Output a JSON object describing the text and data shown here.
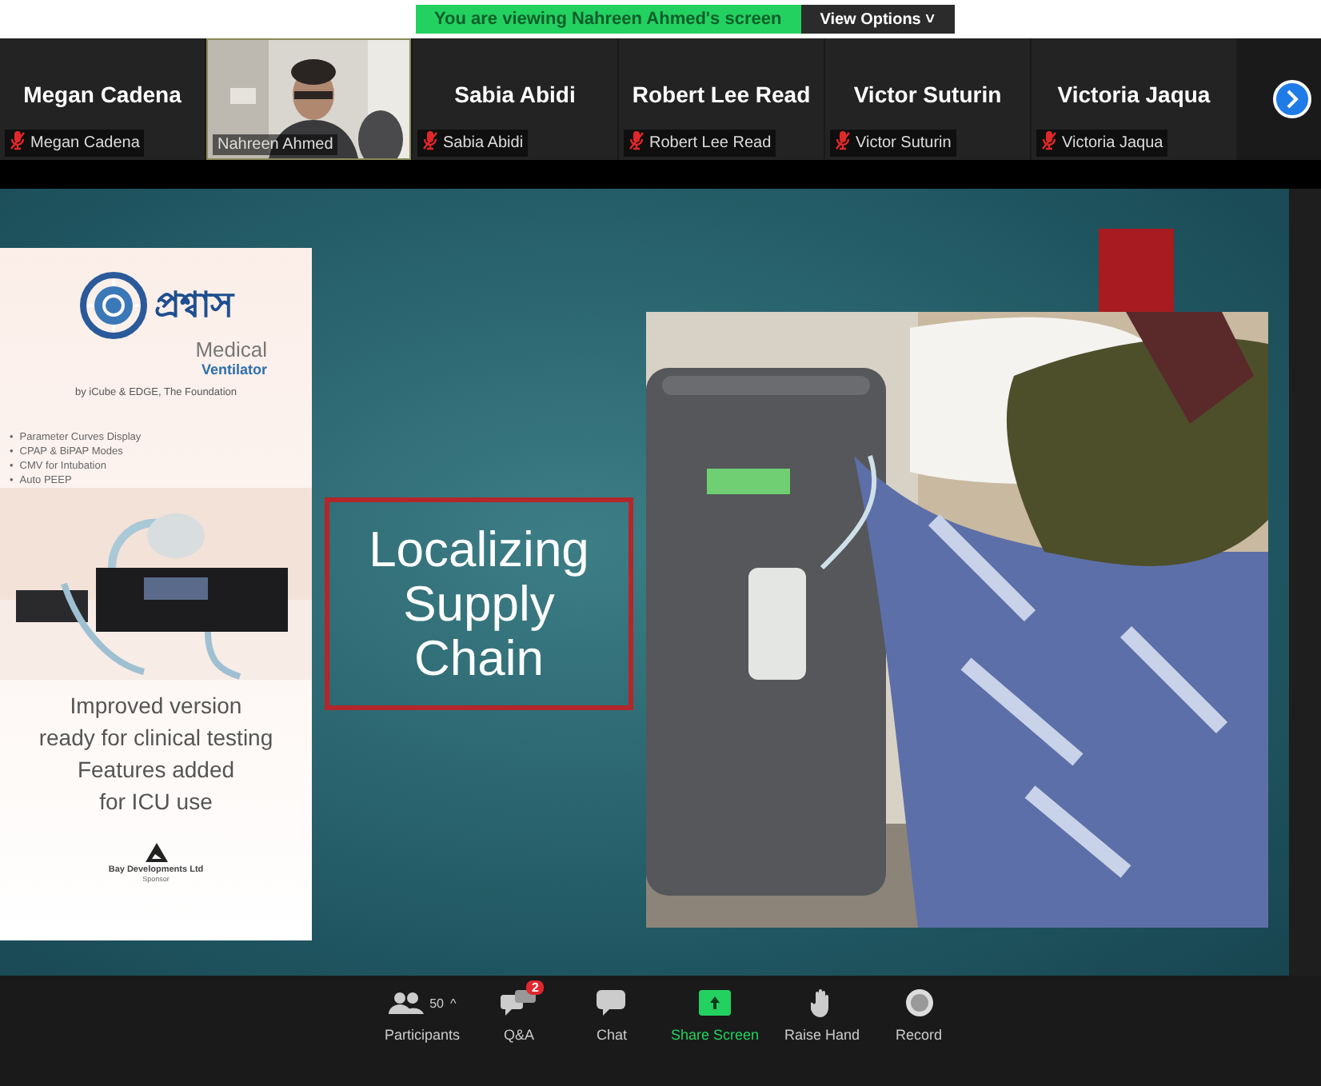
{
  "banner": {
    "text": "You are viewing Nahreen Ahmed's screen",
    "menu": "View Options",
    "menu_caret": "˅"
  },
  "participants": [
    {
      "kind": "name",
      "name": "Megan Cadena",
      "label": "Megan Cadena",
      "muted": true
    },
    {
      "kind": "video",
      "label": "Nahreen Ahmed",
      "muted": false
    },
    {
      "kind": "name",
      "name": "Sabia Abidi",
      "label": "Sabia Abidi",
      "muted": true
    },
    {
      "kind": "name",
      "name": "Robert Lee Read",
      "label": "Robert Lee Read",
      "muted": true
    },
    {
      "kind": "name",
      "name": "Victor Suturin",
      "label": "Victor Suturin",
      "muted": true
    },
    {
      "kind": "name",
      "name": "Victoria Jaqua",
      "label": "Victoria Jaqua",
      "muted": true
    }
  ],
  "slide": {
    "poster": {
      "wordmark": "প্রশ্বাস",
      "title": "Medical",
      "subtitle": "Ventilator",
      "byline": "by iCube  &  EDGE, The Foundation",
      "features": [
        {
          "bullet": "•",
          "text": "Parameter Curves Display"
        },
        {
          "bullet": "•",
          "text": "CPAP & BiPAP Modes"
        },
        {
          "bullet": "•",
          "text": "CMV for Intubation"
        },
        {
          "bullet": "•",
          "text": "Auto PEEP"
        }
      ],
      "caption": [
        "Improved version",
        "ready for clinical testing",
        "Features added",
        "for ICU use"
      ],
      "sponsor_name": "Bay Developments Ltd",
      "sponsor_label": "Sponsor"
    },
    "headline": "Localizing Supply Chain"
  },
  "toolbar": [
    {
      "kind": "participants",
      "label": "Participants",
      "count": "50",
      "caret": "^"
    },
    {
      "kind": "qa",
      "label": "Q&A",
      "badge": "2"
    },
    {
      "kind": "chat",
      "label": "Chat"
    },
    {
      "kind": "share",
      "label": "Share Screen"
    },
    {
      "kind": "hand",
      "label": "Raise Hand"
    },
    {
      "kind": "record",
      "label": "Record"
    }
  ]
}
